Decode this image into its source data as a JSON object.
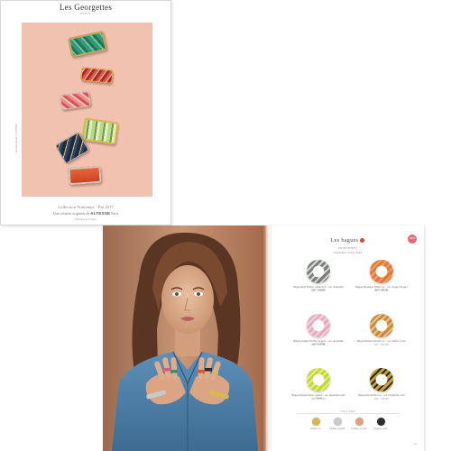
{
  "cover": {
    "brand": "Les Georgettes",
    "brand_sub": "PARIS",
    "side_credit": "Les Georgettes by ALTESSE",
    "collection_line": "Collection Printemps - Été 2017",
    "creation_prefix": "Une création originale de",
    "creation_brand": "ALTESSE",
    "creation_suffix": "Paris",
    "made_in": "Fabriqué en France"
  },
  "product_page": {
    "title": "Les bagues",
    "subtitle_1": "PRINTEMPS",
    "subtitle_2": "Collection mars 2017",
    "badge": "NEW",
    "products": [
      {
        "name": "Bague Stud finition ruthénium - cuir réversible noir / argent",
        "ref": "Réf. : 703340",
        "ring_color": "#7a7f7a",
        "accent": "#d9d9d9"
      },
      {
        "name": "Bague Mosaïque finition or - cuir rouge orangé / bois naturel",
        "ref": "Réf. : 703362",
        "ring_color": "#e07a3c",
        "accent": "#f2a062"
      },
      {
        "name": "Bague Origami finition argent - cuir réversible rose fuchsia",
        "ref": "Réf. : 703353",
        "ring_color": "#e5a9c0",
        "accent": "#f7d3df"
      },
      {
        "name": "Bague Bohème finition or - cuir ambre / brun",
        "ref": "Réf. : 703356",
        "ring_color": "#c98b43",
        "accent": "#f0c27d"
      },
      {
        "name": "Bague Feuille finition argent - cuir réversible vert / jaune",
        "ref": "Réf. : 703344",
        "ring_color": "#c4d63c",
        "accent": "#e5ef8a"
      },
      {
        "name": "Bague Pois finition or - cuir moutarde / noir",
        "ref": "Réf. : 703355",
        "ring_color": "#caa13a",
        "accent": "#2b2b2b"
      }
    ],
    "finishes_label": "FINITIONS",
    "finishes": [
      {
        "name": "Finition or",
        "color": "#d8b650"
      },
      {
        "name": "Finition argent",
        "color": "#c9c9c9"
      },
      {
        "name": "Finition or rose",
        "color": "#e3a17f"
      },
      {
        "name": "Finition noire",
        "color": "#2e2e2e"
      }
    ],
    "page_number": "17"
  },
  "colors": {
    "cover_background": "#f2c2b0",
    "photo_background": "#b77f5c",
    "accent_red": "#d9473c"
  }
}
